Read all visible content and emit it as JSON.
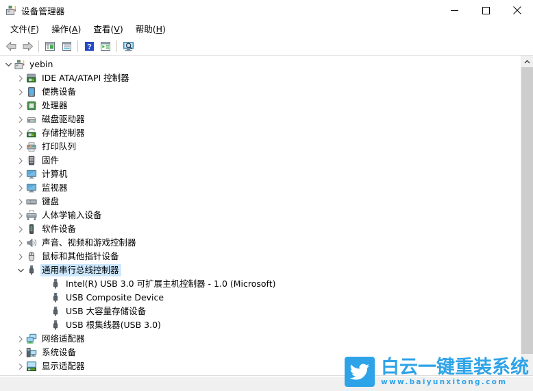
{
  "window": {
    "title": "设备管理器",
    "title_icon": "device-manager-icon",
    "controls": [
      {
        "name": "minimize-button",
        "glyph": "minimize-icon"
      },
      {
        "name": "maximize-button",
        "glyph": "maximize-icon"
      },
      {
        "name": "close-button",
        "glyph": "close-icon"
      }
    ]
  },
  "menubar": {
    "items": [
      {
        "label": "文件",
        "accel": "F"
      },
      {
        "label": "操作",
        "accel": "A"
      },
      {
        "label": "查看",
        "accel": "V"
      },
      {
        "label": "帮助",
        "accel": "H"
      }
    ]
  },
  "toolbar": {
    "buttons": [
      {
        "name": "back-button",
        "icon": "back-arrow-icon"
      },
      {
        "name": "forward-button",
        "icon": "forward-arrow-icon"
      },
      {
        "name": "separator-1",
        "icon": "separator"
      },
      {
        "name": "properties-button",
        "icon": "properties-icon"
      },
      {
        "name": "show-hidden-button",
        "icon": "list-view-icon"
      },
      {
        "name": "separator-2",
        "icon": "separator"
      },
      {
        "name": "help-button",
        "icon": "help-icon"
      },
      {
        "name": "scan-hardware-changes-button",
        "icon": "scan-icon"
      },
      {
        "name": "separator-3",
        "icon": "separator"
      },
      {
        "name": "update-driver-button",
        "icon": "monitor-search-icon"
      }
    ]
  },
  "tree": {
    "nodes": [
      {
        "label": "yebin",
        "depth": 0,
        "state": "expanded",
        "icon": "computer-node-icon",
        "selected": false
      },
      {
        "label": "IDE ATA/ATAPI 控制器",
        "depth": 1,
        "state": "collapsed",
        "icon": "ide-controller-icon",
        "selected": false
      },
      {
        "label": "便携设备",
        "depth": 1,
        "state": "collapsed",
        "icon": "portable-device-icon",
        "selected": false
      },
      {
        "label": "处理器",
        "depth": 1,
        "state": "collapsed",
        "icon": "processor-icon",
        "selected": false
      },
      {
        "label": "磁盘驱动器",
        "depth": 1,
        "state": "collapsed",
        "icon": "disk-drive-icon",
        "selected": false
      },
      {
        "label": "存储控制器",
        "depth": 1,
        "state": "collapsed",
        "icon": "storage-controller-icon",
        "selected": false
      },
      {
        "label": "打印队列",
        "depth": 1,
        "state": "collapsed",
        "icon": "printer-icon",
        "selected": false
      },
      {
        "label": "固件",
        "depth": 1,
        "state": "collapsed",
        "icon": "firmware-icon",
        "selected": false
      },
      {
        "label": "计算机",
        "depth": 1,
        "state": "collapsed",
        "icon": "monitor-icon",
        "selected": false
      },
      {
        "label": "监视器",
        "depth": 1,
        "state": "collapsed",
        "icon": "monitor-icon",
        "selected": false
      },
      {
        "label": "键盘",
        "depth": 1,
        "state": "collapsed",
        "icon": "keyboard-icon",
        "selected": false
      },
      {
        "label": "人体学输入设备",
        "depth": 1,
        "state": "collapsed",
        "icon": "hid-icon",
        "selected": false
      },
      {
        "label": "软件设备",
        "depth": 1,
        "state": "collapsed",
        "icon": "software-device-icon",
        "selected": false
      },
      {
        "label": "声音、视频和游戏控制器",
        "depth": 1,
        "state": "collapsed",
        "icon": "speaker-icon",
        "selected": false
      },
      {
        "label": "鼠标和其他指针设备",
        "depth": 1,
        "state": "collapsed",
        "icon": "mouse-icon",
        "selected": false
      },
      {
        "label": "通用串行总线控制器",
        "depth": 1,
        "state": "expanded",
        "icon": "usb-icon",
        "selected": true
      },
      {
        "label": "Intel(R) USB 3.0 可扩展主机控制器 - 1.0 (Microsoft)",
        "depth": 2,
        "state": "leaf",
        "icon": "usb-icon",
        "selected": false
      },
      {
        "label": "USB Composite Device",
        "depth": 2,
        "state": "leaf",
        "icon": "usb-icon",
        "selected": false
      },
      {
        "label": "USB 大容量存储设备",
        "depth": 2,
        "state": "leaf",
        "icon": "usb-icon",
        "selected": false
      },
      {
        "label": "USB 根集线器(USB 3.0)",
        "depth": 2,
        "state": "leaf",
        "icon": "usb-icon",
        "selected": false
      },
      {
        "label": "网络适配器",
        "depth": 1,
        "state": "collapsed",
        "icon": "network-adapter-icon",
        "selected": false
      },
      {
        "label": "系统设备",
        "depth": 1,
        "state": "collapsed",
        "icon": "system-device-icon",
        "selected": false
      },
      {
        "label": "显示适配器",
        "depth": 1,
        "state": "collapsed",
        "icon": "display-adapter-icon",
        "selected": false
      }
    ]
  },
  "scrollbar": {
    "up_arrow": "chevron-up-icon",
    "thumb_position": "top"
  },
  "statusbar": {
    "text": ""
  },
  "watermark": {
    "brand": "白云一键重装系统",
    "url": "www.baiyunxitong.com",
    "logo": "bird-icon",
    "color": "#2ea3e8"
  },
  "colors": {
    "selection": "#cce8ff",
    "window_bg": "#ffffff",
    "chrome_bg": "#f0f0f0",
    "brand": "#2ea3e8"
  }
}
